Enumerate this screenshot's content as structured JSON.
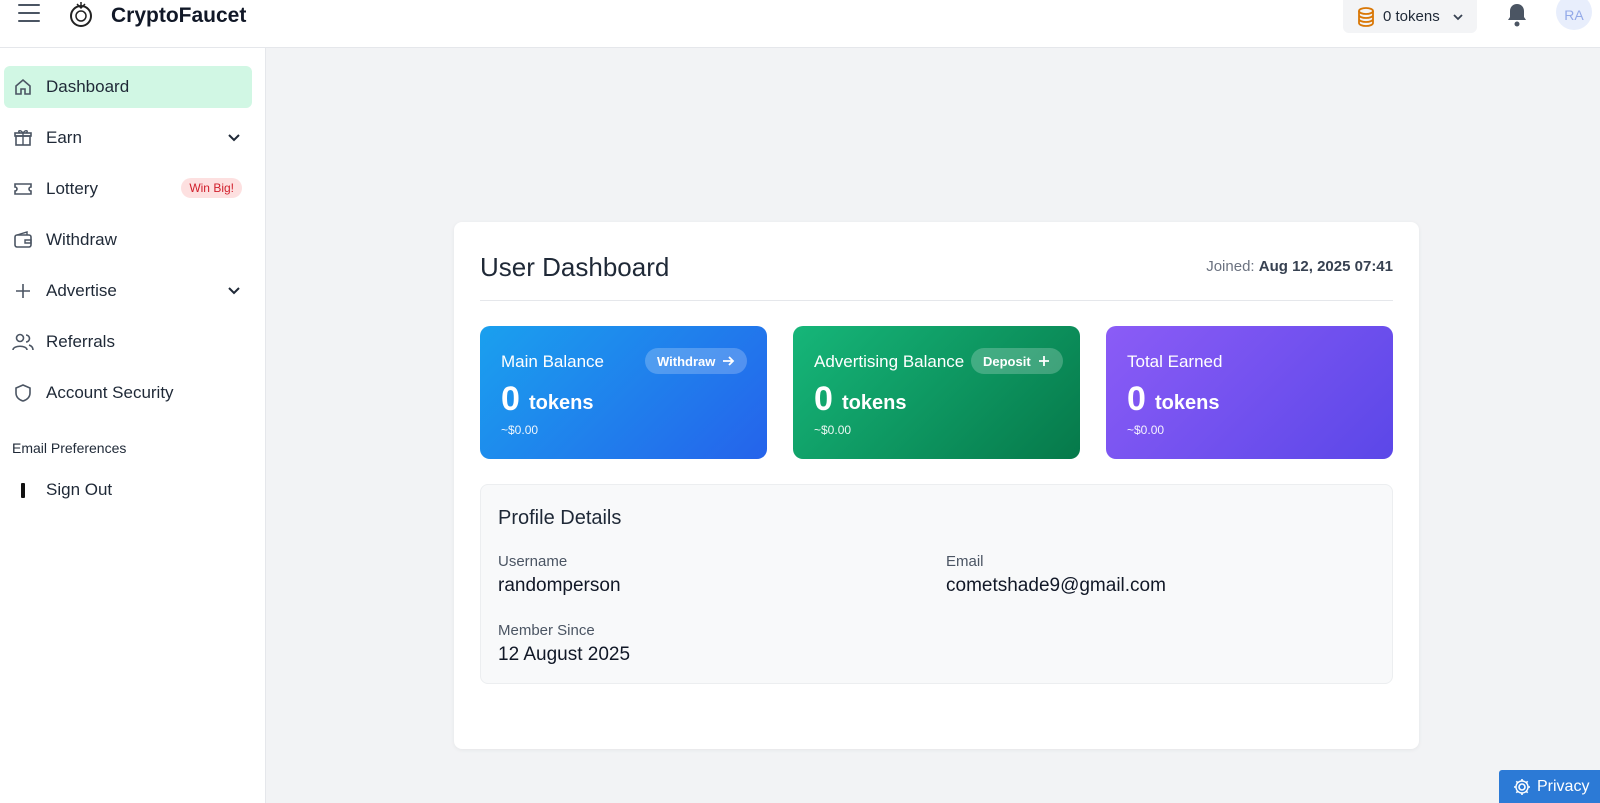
{
  "header": {
    "brand": "CryptoFaucet",
    "token_pill": "0 tokens",
    "avatar_initials": "RA"
  },
  "sidebar": {
    "items": [
      {
        "label": "Dashboard",
        "icon": "home-icon",
        "active": true
      },
      {
        "label": "Earn",
        "icon": "gift-icon",
        "expandable": true
      },
      {
        "label": "Lottery",
        "icon": "ticket-icon",
        "badge": "Win Big!"
      },
      {
        "label": "Withdraw",
        "icon": "wallet-icon"
      },
      {
        "label": "Advertise",
        "icon": "plus-icon",
        "expandable": true
      },
      {
        "label": "Referrals",
        "icon": "users-icon"
      },
      {
        "label": "Account Security",
        "icon": "shield-icon"
      }
    ],
    "email_preferences": "Email Preferences",
    "sign_out": "Sign Out"
  },
  "dashboard": {
    "title": "User Dashboard",
    "joined_label": "Joined:",
    "joined_value": "Aug 12, 2025 07:41",
    "balances": [
      {
        "label": "Main Balance",
        "value": "0",
        "unit": "tokens",
        "usd": "~$0.00",
        "button": "Withdraw",
        "color": "#2563eb"
      },
      {
        "label": "Advertising Balance",
        "value": "0",
        "unit": "tokens",
        "usd": "~$0.00",
        "button": "Deposit",
        "color": "#06794a"
      },
      {
        "label": "Total Earned",
        "value": "0",
        "unit": "tokens",
        "usd": "~$0.00",
        "color": "#5b47e8"
      }
    ],
    "profile": {
      "title": "Profile Details",
      "username_label": "Username",
      "username": "randomperson",
      "email_label": "Email",
      "email": "cometshade9@gmail.com",
      "member_since_label": "Member Since",
      "member_since": "12 August 2025"
    }
  },
  "privacy_button": "Privacy",
  "colors": {
    "accent_active": "#d1f7e4",
    "badge_bg": "#fde0e0",
    "badge_text": "#d11f2c",
    "privacy_bg": "#2c7ad6"
  }
}
